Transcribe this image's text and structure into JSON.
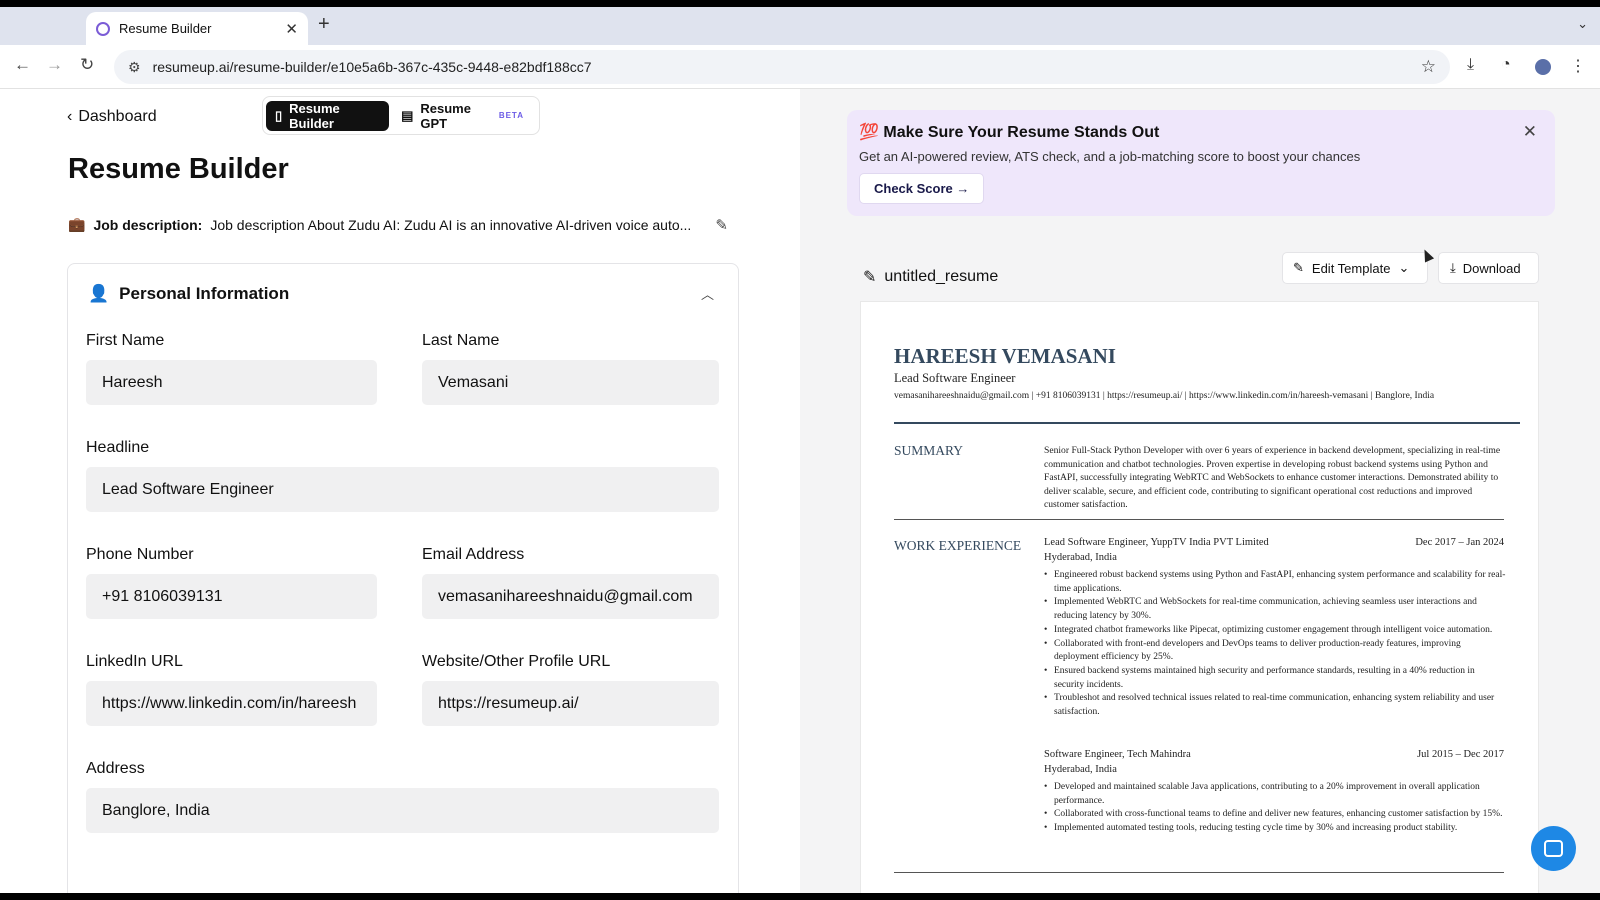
{
  "browser": {
    "tab_title": "Resume Builder",
    "tab_close": "✕",
    "new_tab": "+",
    "url": "resumeup.ai/resume-builder/e10e5a6b-367c-435c-9448-e82bdf188cc7"
  },
  "nav": {
    "back_label": "Dashboard",
    "resume_builder_tab": "Resume Builder",
    "resume_gpt_tab": "Resume GPT",
    "beta_badge": "BETA"
  },
  "page_title": "Resume Builder",
  "job_description": {
    "label": "Job description:",
    "value": "Job description About Zudu AI: Zudu AI is an innovative AI-driven voice auto..."
  },
  "personal_info": {
    "heading": "Personal Information",
    "first_name": {
      "label": "First Name",
      "value": "Hareesh"
    },
    "last_name": {
      "label": "Last Name",
      "value": "Vemasani"
    },
    "headline": {
      "label": "Headline",
      "value": "Lead Software Engineer"
    },
    "phone": {
      "label": "Phone Number",
      "value": "+91 8106039131"
    },
    "email": {
      "label": "Email Address",
      "value": "vemasanihareeshnaidu@gmail.com"
    },
    "linkedin": {
      "label": "LinkedIn URL",
      "value": "https://www.linkedin.com/in/hareesh"
    },
    "website": {
      "label": "Website/Other Profile URL",
      "value": "https://resumeup.ai/"
    },
    "address": {
      "label": "Address",
      "value": "Banglore, India"
    }
  },
  "promo": {
    "emoji": "💯",
    "title": "Make Sure Your Resume Stands Out",
    "text": "Get an AI-powered review, ATS check, and a job-matching score to boost your chances",
    "button": "Check Score →"
  },
  "file": {
    "name": "untitled_resume",
    "edit_template": "Edit Template",
    "download": "Download"
  },
  "resume": {
    "name": "HAREESH VEMASANI",
    "headline": "Lead Software Engineer",
    "contact": "vemasanihareeshnaidu@gmail.com  |  +91 8106039131  |  https://resumeup.ai/  |  https://www.linkedin.com/in/hareesh-vemasani  |  Banglore, India",
    "summary_title": "SUMMARY",
    "summary": "Senior Full-Stack Python Developer with over 6 years of experience in backend development, specializing in real-time communication and chatbot technologies. Proven expertise in developing robust backend systems using Python and FastAPI, successfully integrating WebRTC and WebSockets to enhance customer interactions. Demonstrated ability to deliver scalable, secure, and efficient code, contributing to significant operational cost reductions and improved customer satisfaction.",
    "work_title": "WORK EXPERIENCE",
    "jobs": [
      {
        "title": "Lead Software Engineer, YuppTV India PVT Limited",
        "dates": "Dec 2017 – Jan 2024",
        "location": "Hyderabad, India",
        "bullets": [
          "Engineered robust backend systems using Python and FastAPI, enhancing system performance and scalability for real-time applications.",
          "Implemented WebRTC and WebSockets for real-time communication, achieving seamless user interactions and reducing latency by 30%.",
          "Integrated chatbot frameworks like Pipecat, optimizing customer engagement through intelligent voice automation.",
          "Collaborated with front-end developers and DevOps teams to deliver production-ready features, improving deployment efficiency by 25%.",
          "Ensured backend systems maintained high security and performance standards, resulting in a 40% reduction in security incidents.",
          "Troubleshot and resolved technical issues related to real-time communication, enhancing system reliability and user satisfaction."
        ]
      },
      {
        "title": "Software Engineer, Tech Mahindra",
        "dates": "Jul 2015 – Dec 2017",
        "location": "Hyderabad, India",
        "bullets": [
          "Developed and maintained scalable Java applications, contributing to a 20% improvement in overall application performance.",
          "Collaborated with cross-functional teams to define and deliver new features, enhancing customer satisfaction by 15%.",
          "Implemented automated testing tools, reducing testing cycle time by 30% and increasing product stability."
        ]
      }
    ]
  }
}
